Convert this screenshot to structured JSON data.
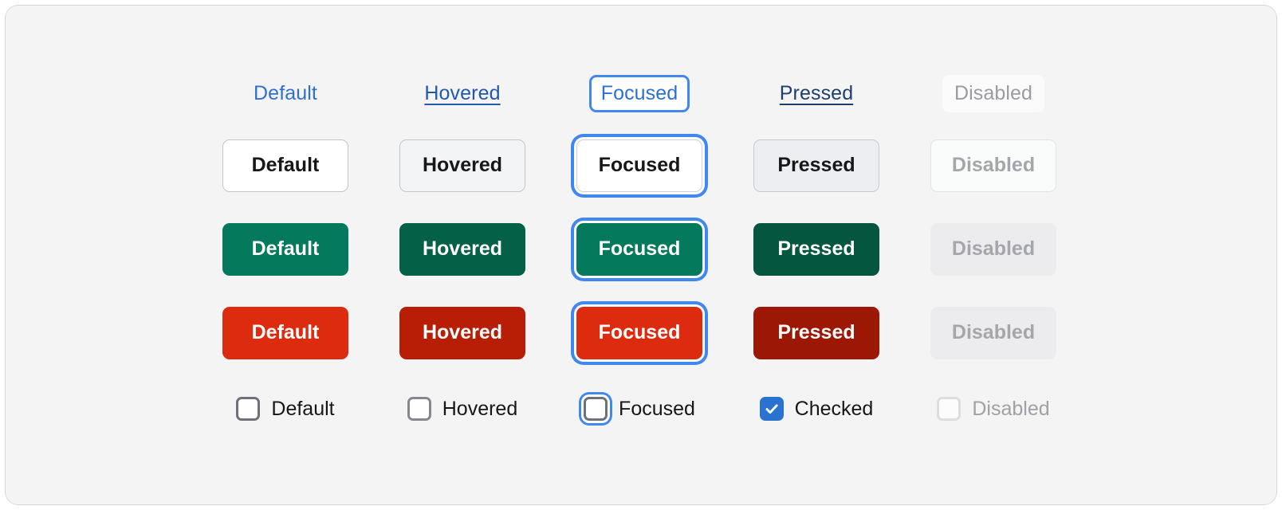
{
  "component_matrix": {
    "states": [
      "Default",
      "Hovered",
      "Focused",
      "Pressed",
      "Disabled"
    ],
    "rows": {
      "links": {
        "name": "link",
        "items": [
          {
            "label": "Default",
            "state": "default"
          },
          {
            "label": "Hovered",
            "state": "hovered"
          },
          {
            "label": "Focused",
            "state": "focused"
          },
          {
            "label": "Pressed",
            "state": "pressed"
          },
          {
            "label": "Disabled",
            "state": "disabled"
          }
        ]
      },
      "secondary_buttons": {
        "name": "secondary-button",
        "items": [
          {
            "label": "Default",
            "state": "default"
          },
          {
            "label": "Hovered",
            "state": "hovered"
          },
          {
            "label": "Focused",
            "state": "focused"
          },
          {
            "label": "Pressed",
            "state": "pressed"
          },
          {
            "label": "Disabled",
            "state": "disabled"
          }
        ]
      },
      "primary_buttons": {
        "name": "primary-button",
        "items": [
          {
            "label": "Default",
            "state": "default"
          },
          {
            "label": "Hovered",
            "state": "hovered"
          },
          {
            "label": "Focused",
            "state": "focused"
          },
          {
            "label": "Pressed",
            "state": "pressed"
          },
          {
            "label": "Disabled",
            "state": "disabled"
          }
        ]
      },
      "danger_buttons": {
        "name": "danger-button",
        "items": [
          {
            "label": "Default",
            "state": "default"
          },
          {
            "label": "Hovered",
            "state": "hovered"
          },
          {
            "label": "Focused",
            "state": "focused"
          },
          {
            "label": "Pressed",
            "state": "pressed"
          },
          {
            "label": "Disabled",
            "state": "disabled"
          }
        ]
      },
      "checkboxes": {
        "name": "checkbox",
        "items": [
          {
            "label": "Default",
            "state": "default",
            "checked": false
          },
          {
            "label": "Hovered",
            "state": "hovered",
            "checked": false
          },
          {
            "label": "Focused",
            "state": "focused",
            "checked": false
          },
          {
            "label": "Checked",
            "state": "checked",
            "checked": true
          },
          {
            "label": "Disabled",
            "state": "disabled",
            "checked": false
          }
        ]
      }
    }
  },
  "colors": {
    "page_background": "#ffffff",
    "panel_background": "#f4f4f5",
    "panel_border": "#d6d8dc",
    "link_default": "#2f6fd0",
    "link_hovered": "#2059ad",
    "link_pressed": "#1d3f6d",
    "link_disabled": "#9b9ba1",
    "focus_ring": "#4087f0",
    "primary_default": "#04795b",
    "primary_hovered": "#046148",
    "primary_pressed": "#04563f",
    "danger_default": "#dd2b10",
    "danger_hovered": "#b81d06",
    "danger_pressed": "#9c1805",
    "disabled_background": "#ececee",
    "disabled_text": "#a5a6ab",
    "checkbox_border": "#6f7179",
    "checkbox_checked": "#2a72cf",
    "text_primary": "#17171a"
  },
  "icons": {
    "checkmark": "check-icon"
  }
}
